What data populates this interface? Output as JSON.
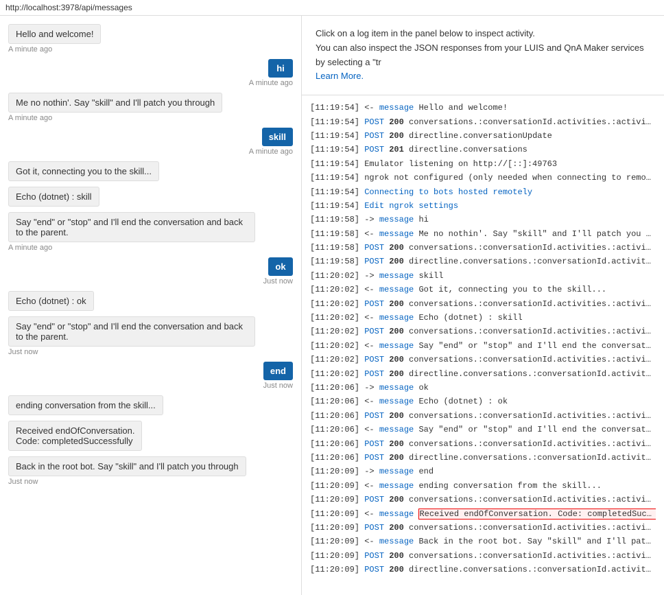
{
  "topbar": {
    "url": "http://localhost:3978/api/messages"
  },
  "info": {
    "line1": "Click on a log item in the panel below to inspect activity.",
    "line2": "You can also inspect the JSON responses from your LUIS and QnA Maker services by selecting a \"tr",
    "learn_more": "Learn More."
  },
  "chat": {
    "messages": [
      {
        "type": "bot",
        "text": "Hello and welcome!",
        "time": "A minute ago"
      },
      {
        "type": "user",
        "text": "hi",
        "time": "A minute ago"
      },
      {
        "type": "bot",
        "text": "Me no nothin'. Say \"skill\" and I'll patch you through",
        "time": "A minute ago"
      },
      {
        "type": "user",
        "text": "skill",
        "time": "A minute ago"
      },
      {
        "type": "bot",
        "text": "Got it, connecting you to the skill...",
        "time": ""
      },
      {
        "type": "bot",
        "text": "Echo (dotnet) : skill",
        "time": ""
      },
      {
        "type": "bot",
        "text": "Say \"end\" or \"stop\" and I'll end the conversation and back to the parent.",
        "time": "A minute ago"
      },
      {
        "type": "user",
        "text": "ok",
        "time": "Just now"
      },
      {
        "type": "bot",
        "text": "Echo (dotnet) : ok",
        "time": ""
      },
      {
        "type": "bot",
        "text": "Say \"end\" or \"stop\" and I'll end the conversation and back to the parent.",
        "time": "Just now"
      },
      {
        "type": "user",
        "text": "end",
        "time": "Just now"
      },
      {
        "type": "bot",
        "text": "ending conversation from the skill...",
        "time": ""
      },
      {
        "type": "bot",
        "text": "Received endOfConversation.\nCode: completedSuccessfully",
        "time": ""
      },
      {
        "type": "bot",
        "text": "Back in the root bot. Say \"skill\" and I'll patch you through",
        "time": "Just now"
      }
    ]
  },
  "log": {
    "entries": [
      {
        "time": "[11:19:54]",
        "arrow": "<-",
        "type": "message",
        "rest": " Hello and welcome!",
        "highlight": false
      },
      {
        "time": "[11:19:54]",
        "arrow": "",
        "type": "POST 200",
        "rest": " conversations.:conversationId.activities.:activityId",
        "highlight": false
      },
      {
        "time": "[11:19:54]",
        "arrow": "",
        "type": "POST 200",
        "rest": " directline.conversationUpdate",
        "highlight": false
      },
      {
        "time": "[11:19:54]",
        "arrow": "",
        "type": "POST 201",
        "rest": " directline.conversations",
        "highlight": false
      },
      {
        "time": "[11:19:54]",
        "arrow": "",
        "type": "",
        "rest": " Emulator listening on http://[::]:49763",
        "highlight": false
      },
      {
        "time": "[11:19:54]",
        "arrow": "",
        "type": "",
        "rest": " ngrok not configured (only needed when connecting to remotely hosted",
        "highlight": false
      },
      {
        "time": "[11:19:54]",
        "arrow": "",
        "type": "link1",
        "rest": "",
        "highlight": false
      },
      {
        "time": "[11:19:54]",
        "arrow": "",
        "type": "link2",
        "rest": "",
        "highlight": false
      },
      {
        "time": "[11:19:58]",
        "arrow": "->",
        "type": "message",
        "rest": " hi",
        "highlight": false
      },
      {
        "time": "[11:19:58]",
        "arrow": "<-",
        "type": "message",
        "rest": " Me no nothin'. Say \"skill\" and I'll patch you thro...",
        "highlight": false
      },
      {
        "time": "[11:19:58]",
        "arrow": "",
        "type": "POST 200",
        "rest": " conversations.:conversationId.activities.:activityId",
        "highlight": false
      },
      {
        "time": "[11:19:58]",
        "arrow": "",
        "type": "POST 200",
        "rest": " directline.conversations.:conversationId.activities",
        "highlight": false
      },
      {
        "time": "[11:20:02]",
        "arrow": "->",
        "type": "message",
        "rest": " skill",
        "highlight": false
      },
      {
        "time": "[11:20:02]",
        "arrow": "<-",
        "type": "message",
        "rest": " Got it, connecting you to the skill...",
        "highlight": false
      },
      {
        "time": "[11:20:02]",
        "arrow": "",
        "type": "POST 200",
        "rest": " conversations.:conversationId.activities.:activityId",
        "highlight": false
      },
      {
        "time": "[11:20:02]",
        "arrow": "<-",
        "type": "message",
        "rest": " Echo (dotnet) : skill",
        "highlight": false
      },
      {
        "time": "[11:20:02]",
        "arrow": "",
        "type": "POST 200",
        "rest": " conversations.:conversationId.activities.:activityId",
        "highlight": false
      },
      {
        "time": "[11:20:02]",
        "arrow": "<-",
        "type": "message",
        "rest": " Say \"end\" or \"stop\" and I'll end the conversation ...",
        "highlight": false
      },
      {
        "time": "[11:20:02]",
        "arrow": "",
        "type": "POST 200",
        "rest": " conversations.:conversationId.activities.:activityId",
        "highlight": false
      },
      {
        "time": "[11:20:02]",
        "arrow": "",
        "type": "POST 200",
        "rest": " directline.conversations.:conversationId.activities",
        "highlight": false
      },
      {
        "time": "[11:20:06]",
        "arrow": "->",
        "type": "message",
        "rest": " ok",
        "highlight": false
      },
      {
        "time": "[11:20:06]",
        "arrow": "<-",
        "type": "message",
        "rest": " Echo (dotnet) : ok",
        "highlight": false
      },
      {
        "time": "[11:20:06]",
        "arrow": "",
        "type": "POST 200",
        "rest": " conversations.:conversationId.activities.:activityId",
        "highlight": false
      },
      {
        "time": "[11:20:06]",
        "arrow": "<-",
        "type": "message",
        "rest": " Say \"end\" or \"stop\" and I'll end the conversation ...",
        "highlight": false
      },
      {
        "time": "[11:20:06]",
        "arrow": "",
        "type": "POST 200",
        "rest": " conversations.:conversationId.activities.:activityId",
        "highlight": false
      },
      {
        "time": "[11:20:06]",
        "arrow": "",
        "type": "POST 200",
        "rest": " directline.conversations.:conversationId.activities",
        "highlight": false
      },
      {
        "time": "[11:20:09]",
        "arrow": "->",
        "type": "message",
        "rest": " end",
        "highlight": false
      },
      {
        "time": "[11:20:09]",
        "arrow": "<-",
        "type": "message",
        "rest": " ending conversation from the skill...",
        "highlight": false
      },
      {
        "time": "[11:20:09]",
        "arrow": "",
        "type": "POST 200",
        "rest": " conversations.:conversationId.activities.:activityId",
        "highlight": false
      },
      {
        "time": "[11:20:09]",
        "arrow": "<-",
        "type": "message_highlight",
        "rest": " Received endOfConversation. Code: completedSucces...",
        "highlight": true
      },
      {
        "time": "[11:20:09]",
        "arrow": "",
        "type": "POST 200",
        "rest": " conversations.:conversationId.activities.:activityId",
        "highlight": false
      },
      {
        "time": "[11:20:09]",
        "arrow": "<-",
        "type": "message",
        "rest": " Back in the root bot. Say \"skill\" and I'll patch y...",
        "highlight": false
      },
      {
        "time": "[11:20:09]",
        "arrow": "",
        "type": "POST 200",
        "rest": " conversations.:conversationId.activities.:activityId",
        "highlight": false
      },
      {
        "time": "[11:20:09]",
        "arrow": "",
        "type": "POST 200",
        "rest": " directline.conversations.:conversationId.activities",
        "highlight": false
      }
    ]
  }
}
